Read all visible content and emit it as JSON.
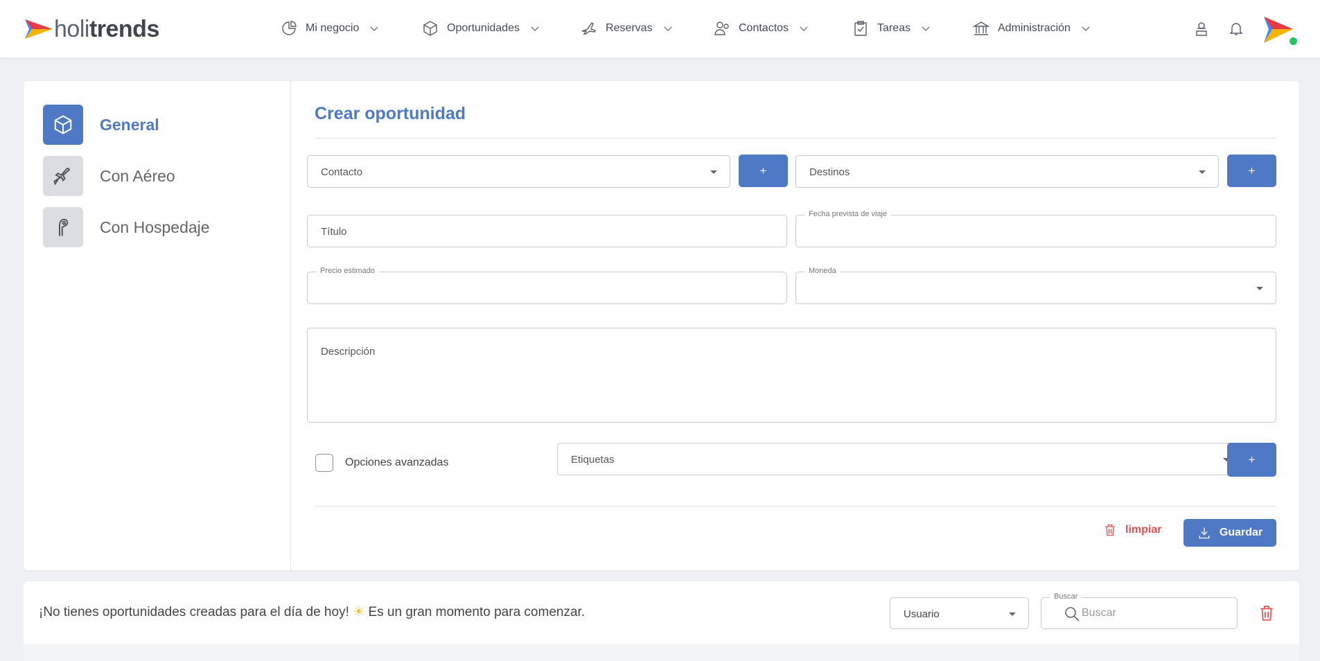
{
  "brand": {
    "name_light": "holi",
    "name_bold": "trends"
  },
  "nav": {
    "items": [
      {
        "label": "Mi negocio",
        "icon": "pie-chart-icon"
      },
      {
        "label": "Oportunidades",
        "icon": "cube-icon"
      },
      {
        "label": "Reservas",
        "icon": "plane-icon"
      },
      {
        "label": "Contactos",
        "icon": "users-icon"
      },
      {
        "label": "Tareas",
        "icon": "clipboard-check-icon"
      },
      {
        "label": "Administración",
        "icon": "bank-icon"
      }
    ],
    "right_icons": [
      "support-agent-icon",
      "bell-icon"
    ]
  },
  "sidebar": {
    "items": [
      {
        "label": "General",
        "icon": "cube-icon",
        "active": true
      },
      {
        "label": "Con Aéreo",
        "icon": "plane-icon",
        "active": false
      },
      {
        "label": "Con Hospedaje",
        "icon": "door-hanger-icon",
        "active": false
      }
    ]
  },
  "form": {
    "title": "Crear oportunidad",
    "contacto_placeholder": "Contacto",
    "destinos_placeholder": "Destinos",
    "add_label": "+",
    "titulo_placeholder": "Título",
    "fecha_legend": "Fecha prevista de viaje",
    "precio_legend": "Precio estimado",
    "moneda_legend": "Moneda",
    "descripcion_placeholder": "Descripción",
    "opciones_label": "Opciones avanzadas",
    "etiquetas_placeholder": "Etiquetas",
    "clear_label": "limpiar",
    "save_label": "Guardar"
  },
  "list_bar": {
    "empty_message_1": "¡No tienes oportunidades creadas para el día de hoy!",
    "empty_message_sun": "☀",
    "empty_message_2": "Es un gran momento para comenzar.",
    "usuario_placeholder": "Usuario",
    "search_legend": "Buscar",
    "search_placeholder": "Buscar"
  },
  "colors": {
    "accent": "#4f79c4",
    "danger": "#e05252",
    "online": "#22c55e"
  }
}
